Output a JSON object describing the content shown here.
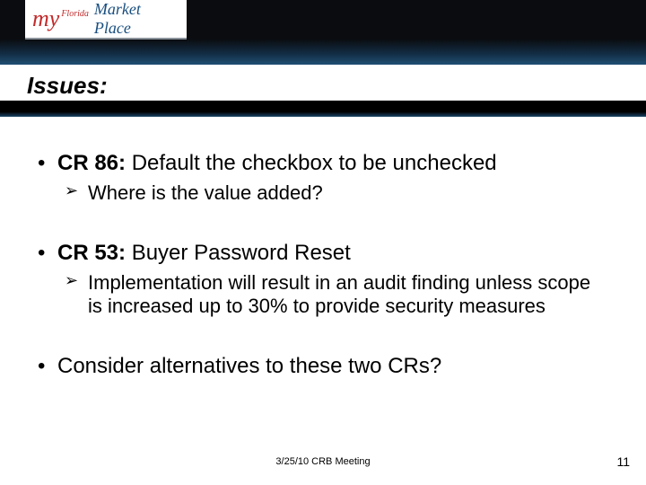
{
  "logo": {
    "my": "my",
    "florida": "Florida",
    "marketplace": "Market Place"
  },
  "title": "Issues:",
  "bullets": [
    {
      "bold": "CR 86:",
      "rest": " Default the checkbox to be unchecked",
      "sub": "Where is the value added?"
    },
    {
      "bold": "CR 53:",
      "rest": " Buyer Password Reset",
      "sub": "Implementation will result in an audit finding unless scope is increased up to 30% to provide security measures"
    },
    {
      "bold": "",
      "rest": "Consider alternatives to these two CRs?",
      "sub": null
    }
  ],
  "footer": {
    "date": "3/25/10 CRB Meeting",
    "page": "11"
  }
}
